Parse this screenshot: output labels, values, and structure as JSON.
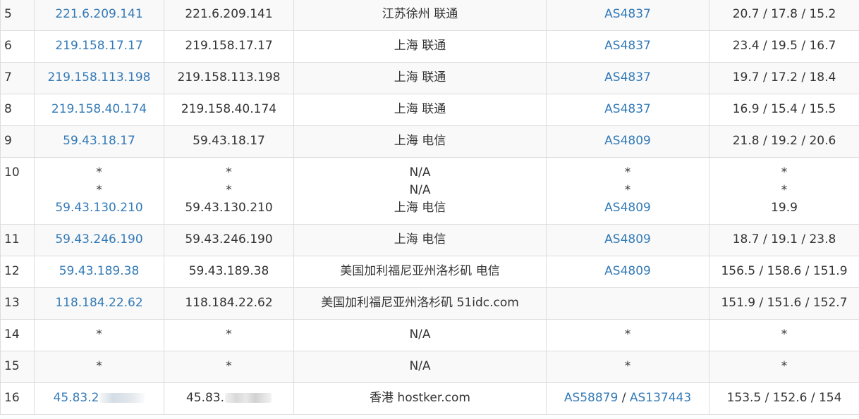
{
  "rows": [
    {
      "hop": "5",
      "ip_link": "221.6.209.141",
      "ip": "221.6.209.141",
      "location": "江苏徐州 联通",
      "asn": "AS4837",
      "rtt": "20.7 / 17.8 / 15.2"
    },
    {
      "hop": "6",
      "ip_link": "219.158.17.17",
      "ip": "219.158.17.17",
      "location": "上海 联通",
      "asn": "AS4837",
      "rtt": "23.4 / 19.5 / 16.7"
    },
    {
      "hop": "7",
      "ip_link": "219.158.113.198",
      "ip": "219.158.113.198",
      "location": "上海 联通",
      "asn": "AS4837",
      "rtt": "19.7 / 17.2 / 18.4"
    },
    {
      "hop": "8",
      "ip_link": "219.158.40.174",
      "ip": "219.158.40.174",
      "location": "上海 联通",
      "asn": "AS4837",
      "rtt": "16.9 / 15.4 / 15.5"
    },
    {
      "hop": "9",
      "ip_link": "59.43.18.17",
      "ip": "59.43.18.17",
      "location": "上海 电信",
      "asn": "AS4809",
      "rtt": "21.8 / 19.2 / 20.6"
    },
    {
      "hop": "10",
      "ip_lines": [
        "*",
        "*",
        "59.43.130.210"
      ],
      "ip_plain_lines": [
        "*",
        "*",
        "59.43.130.210"
      ],
      "location_lines": [
        "N/A",
        "N/A",
        "上海 电信"
      ],
      "asn_lines": [
        "*",
        "*",
        "AS4809"
      ],
      "rtt_lines": [
        "*",
        "*",
        "19.9"
      ]
    },
    {
      "hop": "11",
      "ip_link": "59.43.246.190",
      "ip": "59.43.246.190",
      "location": "上海 电信",
      "asn": "AS4809",
      "rtt": "18.7 / 19.1 / 23.8"
    },
    {
      "hop": "12",
      "ip_link": "59.43.189.38",
      "ip": "59.43.189.38",
      "location": "美国加利福尼亚州洛杉矶 电信",
      "asn": "AS4809",
      "rtt": "156.5 / 158.6 / 151.9"
    },
    {
      "hop": "13",
      "ip_link": "118.184.22.62",
      "ip": "118.184.22.62",
      "location": "美国加利福尼亚州洛杉矶 51idc.com",
      "asn": "",
      "rtt": "151.9 / 151.6 / 152.7"
    },
    {
      "hop": "14",
      "ip_star": "*",
      "ip_plain_star": "*",
      "location": "N/A",
      "asn_star": "*",
      "rtt": "*"
    },
    {
      "hop": "15",
      "ip_star": "*",
      "ip_plain_star": "*",
      "location": "N/A",
      "asn_star": "*",
      "rtt": "*"
    },
    {
      "hop": "16",
      "ip_link": "45.83.2",
      "ip": "45.83.",
      "location": "香港 hostker.com",
      "asn_a": "AS58879",
      "asn_sep": "/",
      "asn_b": "AS137443",
      "rtt": "153.5 / 152.6 / 154"
    }
  ],
  "colors": {
    "link": "#337ab7",
    "text": "#333333",
    "stripe": "#f9f9f9",
    "border": "#dddddd"
  }
}
